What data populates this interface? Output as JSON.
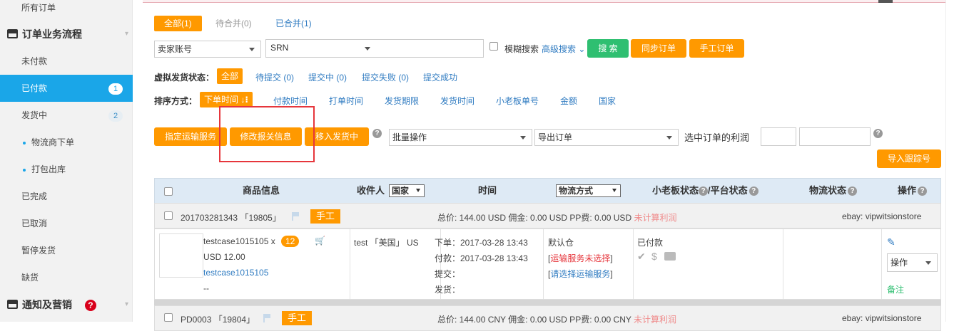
{
  "sidebar": {
    "all_orders": "所有订单",
    "section_flow": "订单业务流程",
    "items": [
      {
        "label": "未付款"
      },
      {
        "label": "已付款",
        "badge": "1"
      },
      {
        "label": "发货中",
        "badge": "2"
      },
      {
        "label": "物流商下单"
      },
      {
        "label": "打包出库"
      },
      {
        "label": "已完成"
      },
      {
        "label": "已取消"
      },
      {
        "label": "暂停发货"
      },
      {
        "label": "缺货"
      }
    ],
    "section_notify": "通知及营销",
    "help": "?"
  },
  "tabs": [
    {
      "label": "全部(1)"
    },
    {
      "label": "待合并(0)"
    },
    {
      "label": "已合并(1)"
    }
  ],
  "filters": {
    "seller_account": "卖家账号",
    "srn": "SRN",
    "fuzzy_search": "模糊搜索",
    "advanced_search": "高级搜索",
    "search_btn": "搜 索",
    "sync_btn": "同步订单",
    "manual_btn": "手工订单"
  },
  "virtual_status": {
    "label": "虚拟发货状态：",
    "options": [
      "全部",
      "待提交 (0)",
      "提交中 (0)",
      "提交失败 (0)",
      "提交成功"
    ]
  },
  "sort": {
    "label": "排序方式：",
    "current": "下单时间",
    "options": [
      "付款时间",
      "打单时间",
      "发货期限",
      "发货时间",
      "小老板单号",
      "金额",
      "国家"
    ]
  },
  "actions": {
    "assign_shipping": "指定运输服务",
    "modify_customs": "修改报关信息",
    "move_to_shipping": "移入发货中",
    "batch_ops": "批量操作",
    "export_orders": "导出订单",
    "selected_profit": "选中订单的利润",
    "import_tracking": "导入跟踪号"
  },
  "table": {
    "headers": {
      "product": "商品信息",
      "recipient": "收件人",
      "country": "国家",
      "time": "时间",
      "shipping_method": "物流方式",
      "status": "小老板状态",
      "platform_status": "/平台状态",
      "logistics_status": "物流状态",
      "ops": "操作"
    },
    "orders": [
      {
        "order_no": "201703281343",
        "code": "「19805」",
        "tag": "手工",
        "summary": "总价: 144.00 USD  佣金: 0.00 USD  PP费: 0.00 USD",
        "profit": "未计算利润",
        "store": "ebay: vipwitsionstore"
      },
      {
        "order_no": "PD0003",
        "code": "「19804」",
        "tag": "手工",
        "summary": "总价: 144.00 CNY  佣金: 0.00 USD  PP费: 0.00 CNY",
        "profit": "未计算利润",
        "store": "ebay: vipwitsionstore"
      }
    ],
    "detail": {
      "product_name": "testcase1015105 x",
      "qty": "12",
      "price": "USD 12.00",
      "sku_link": "testcase1015105",
      "extra": "--",
      "recipient": "test 「美国」 US",
      "order_time": "下单：2017-03-28 13:43",
      "pay_time": "付款：2017-03-28 13:43",
      "submit": "提交：",
      "ship": "发货：",
      "warehouse": "默认仓",
      "shipping_unselected": "运输服务未选择",
      "choose_shipping": "请选择运输服务",
      "paid_status": "已付款",
      "ops_select": "操作",
      "remark": "备注"
    }
  },
  "colors": {
    "accent": "#ff9900",
    "active_blue": "#1aa6e8",
    "link_blue": "#2f7bc1",
    "green": "#2fbf71",
    "red": "#e6363c"
  }
}
